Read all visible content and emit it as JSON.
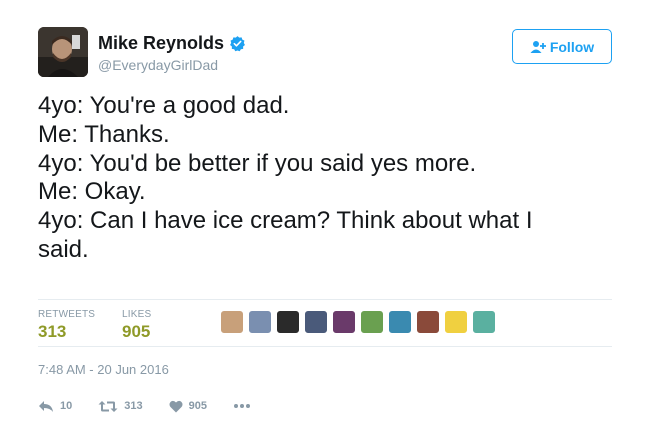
{
  "user": {
    "display_name": "Mike Reynolds",
    "handle": "@EverydayGirlDad",
    "avatar_icon": "profile-photo",
    "verified_icon": "verified-badge-icon"
  },
  "follow_button": {
    "label": "Follow",
    "icon": "add-user-icon"
  },
  "tweet": {
    "lines": [
      "4yo: You're a good dad.",
      "Me: Thanks.",
      "4yo: You'd be better if you said yes more.",
      "Me: Okay.",
      "4yo: Can I have ice cream? Think about what I",
      "said."
    ]
  },
  "stats": {
    "retweets_label": "RETWEETS",
    "retweets_value": "313",
    "likes_label": "LIKES",
    "likes_value": "905",
    "liker_colors": [
      "#c8a07a",
      "#7a8fb0",
      "#2a2a2a",
      "#4a5a7a",
      "#6a3a6a",
      "#6aa050",
      "#3a8ab0",
      "#8a4a3a",
      "#f0d040",
      "#5ab0a0"
    ]
  },
  "timestamp": "7:48 AM - 20 Jun 2016",
  "actions": {
    "reply_count": "10",
    "retweet_count": "313",
    "like_count": "905",
    "reply_icon": "reply-icon",
    "retweet_icon": "retweet-icon",
    "like_icon": "heart-icon",
    "more_icon": "more-icon"
  },
  "colors": {
    "accent": "#1da1f2",
    "stat_value": "#8f9a28",
    "muted": "#8899a6"
  }
}
